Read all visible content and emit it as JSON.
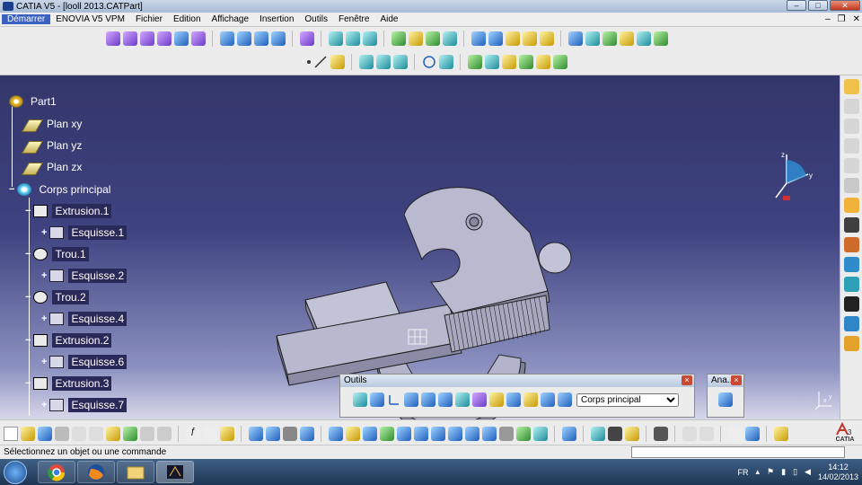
{
  "window": {
    "title": "CATIA V5 - [looll 2013.CATPart]"
  },
  "menu": {
    "items": [
      "Démarrer",
      "ENOVIA V5 VPM",
      "Fichier",
      "Edition",
      "Affichage",
      "Insertion",
      "Outils",
      "Fenêtre",
      "Aide"
    ]
  },
  "tree": {
    "root": "Part1",
    "planes": [
      "Plan xy",
      "Plan yz",
      "Plan zx"
    ],
    "body": "Corps principal",
    "features": [
      {
        "name": "Extrusion.1",
        "sketch": "Esquisse.1"
      },
      {
        "name": "Trou.1",
        "sketch": "Esquisse.2"
      },
      {
        "name": "Trou.2",
        "sketch": "Esquisse.4"
      },
      {
        "name": "Extrusion.2",
        "sketch": "Esquisse.6"
      },
      {
        "name": "Extrusion.3",
        "sketch": "Esquisse.7"
      }
    ]
  },
  "compass": {
    "x_label": "x",
    "y_label": "y",
    "z_label": "z"
  },
  "outils_toolbar": {
    "title": "Outils",
    "body_select": "Corps principal"
  },
  "ana_toolbar": {
    "title": "Ana..."
  },
  "status": {
    "message": "Sélectionnez un objet ou une commande",
    "command_value": ""
  },
  "taskbar": {
    "language": "FR",
    "time": "14:12",
    "date": "14/02/2013"
  },
  "brand": {
    "catia_label": "CATIA"
  },
  "colors": {
    "viewport_top": "#34366a",
    "viewport_bottom": "#d7d8ea",
    "part_fill": "#b3b3cc"
  }
}
